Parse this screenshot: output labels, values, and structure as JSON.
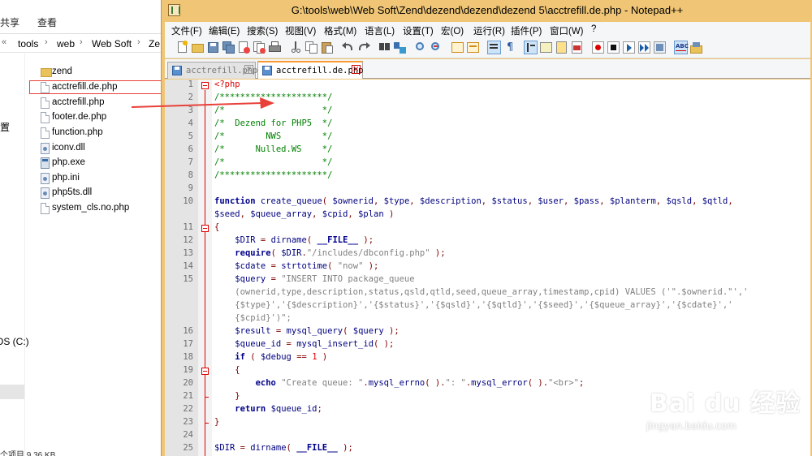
{
  "explorer": {
    "ribbon_tabs": [
      "共享",
      "查看"
    ],
    "breadcrumbs": [
      "tools",
      "web",
      "Web Soft",
      "Ze"
    ],
    "nav_items": [
      {
        "label": "置"
      },
      {
        "label": "OS (C:)"
      }
    ],
    "files": [
      {
        "name": "zend",
        "icon": "folder-icon"
      },
      {
        "name": "acctrefill.de.php",
        "icon": "php-file-icon",
        "selected": true
      },
      {
        "name": "acctrefill.php",
        "icon": "php-file-icon"
      },
      {
        "name": "footer.de.php",
        "icon": "php-file-icon"
      },
      {
        "name": "function.php",
        "icon": "php-file-icon"
      },
      {
        "name": "iconv.dll",
        "icon": "dll-file-icon"
      },
      {
        "name": "php.exe",
        "icon": "exe-file-icon"
      },
      {
        "name": "php.ini",
        "icon": "ini-file-icon"
      },
      {
        "name": "php5ts.dll",
        "icon": "dll-file-icon"
      },
      {
        "name": "system_cls.no.php",
        "icon": "php-file-icon"
      }
    ],
    "status": "个项目  9.36 KB"
  },
  "notepad": {
    "title": "G:\\tools\\web\\Web Soft\\Zend\\dezend\\dezend\\dezend 5\\acctrefill.de.php - Notepad++",
    "menu": [
      "文件(F)",
      "编辑(E)",
      "搜索(S)",
      "视图(V)",
      "格式(M)",
      "语言(L)",
      "设置(T)",
      "宏(O)",
      "运行(R)",
      "插件(P)",
      "窗口(W)",
      "?"
    ],
    "toolbar_icons": [
      "new-file-icon",
      "open-file-icon",
      "save-icon",
      "save-all-icon",
      "close-icon",
      "close-all-icon",
      "print-icon",
      "cut-icon",
      "copy-icon",
      "paste-icon",
      "undo-icon",
      "redo-icon",
      "find-icon",
      "replace-icon",
      "zoom-in-icon",
      "zoom-out-icon",
      "sync-vertical-icon",
      "sync-horizontal-icon",
      "word-wrap-icon",
      "show-all-chars-icon",
      "indent-guide-icon",
      "user-lang-icon",
      "doc-map-icon",
      "function-list-icon",
      "record-macro-icon",
      "stop-macro-icon",
      "play-macro-icon",
      "run-macro-multiple-icon",
      "save-macro-icon",
      "spellcheck-icon",
      "extra-icon"
    ],
    "tabs": [
      {
        "label": "acctrefill.php",
        "active": false
      },
      {
        "label": "acctrefill.de.php",
        "active": true
      }
    ],
    "lines": [
      {
        "n": "1",
        "code": "<?php"
      },
      {
        "n": "2",
        "code": "/*********************/"
      },
      {
        "n": "3",
        "code": "/*                   */"
      },
      {
        "n": "4",
        "code": "/*  Dezend for PHP5  */"
      },
      {
        "n": "5",
        "code": "/*        NWS        */"
      },
      {
        "n": "6",
        "code": "/*      Nulled.WS    */"
      },
      {
        "n": "7",
        "code": "/*                   */"
      },
      {
        "n": "8",
        "code": "/*********************/"
      },
      {
        "n": "9",
        "code": ""
      },
      {
        "n": "10",
        "code": "function create_queue( $ownerid, $type, $description, $status, $user, $pass, $planterm, $qsld, $qtld,"
      },
      {
        "n": "",
        "code": "$seed, $queue_array, $cpid, $plan )"
      },
      {
        "n": "11",
        "code": "{"
      },
      {
        "n": "12",
        "code": "    $DIR = dirname( __FILE__ );"
      },
      {
        "n": "13",
        "code": "    require( $DIR.\"/includes/dbconfig.php\" );"
      },
      {
        "n": "14",
        "code": "    $cdate = strtotime( \"now\" );"
      },
      {
        "n": "15",
        "code": "    $query = \"INSERT INTO package_queue"
      },
      {
        "n": "",
        "code": "    (ownerid,type,description,status,qsld,qtld,seed,queue_array,timestamp,cpid) VALUES ('\".$ownerid.\"','"
      },
      {
        "n": "",
        "code": "    {$type}','{$description}','{$status}','{$qsld}','{$qtld}','{$seed}','{$queue_array}','{$cdate}','"
      },
      {
        "n": "",
        "code": "    {$cpid}')\";"
      },
      {
        "n": "16",
        "code": "    $result = mysql_query( $query );"
      },
      {
        "n": "17",
        "code": "    $queue_id = mysql_insert_id( );"
      },
      {
        "n": "18",
        "code": "    if ( $debug == 1 )"
      },
      {
        "n": "19",
        "code": "    {"
      },
      {
        "n": "20",
        "code": "        echo \"Create queue: \".mysql_errno( ).\": \".mysql_error( ).\"<br>\";"
      },
      {
        "n": "21",
        "code": "    }"
      },
      {
        "n": "22",
        "code": "    return $queue_id;"
      },
      {
        "n": "23",
        "code": "}"
      },
      {
        "n": "24",
        "code": ""
      },
      {
        "n": "25",
        "code": "$DIR = dirname( __FILE__ );"
      }
    ]
  },
  "watermark": {
    "logo": "Bai du 经验",
    "url": "jingyan.baidu.com"
  },
  "colors": {
    "title_bar": "#f0c676",
    "selection_box": "#e8413a",
    "arrow": "#e8413a",
    "comment": "#008000",
    "keyword": "#00008b",
    "string": "#808080",
    "number": "#e00000"
  }
}
